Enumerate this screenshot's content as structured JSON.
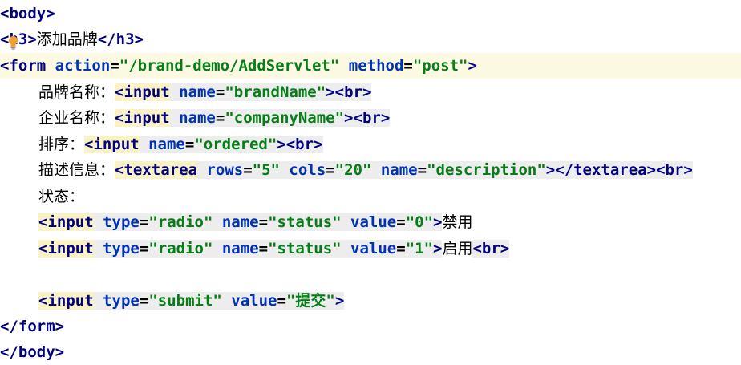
{
  "editor": {
    "language": "html",
    "lines": [
      {
        "tag_open": "<body>"
      },
      {
        "tag_open": "<h3>",
        "text": "添加品牌",
        "tag_close": "</h3>"
      },
      {
        "tag_open": "<form",
        "attrs": [
          {
            "name": "action",
            "value": "\"/brand-demo/AddServlet\""
          },
          {
            "name": "method",
            "value": "\"post\""
          }
        ],
        "tag_end": ">"
      },
      {
        "label": "品牌名称：",
        "tag_open": "<input",
        "attrs": [
          {
            "name": "name",
            "value": "\"brandName\""
          }
        ],
        "tag_end": ">",
        "trailing_tag": "<br>"
      },
      {
        "label": "企业名称：",
        "tag_open": "<input",
        "attrs": [
          {
            "name": "name",
            "value": "\"companyName\""
          }
        ],
        "tag_end": ">",
        "trailing_tag": "<br>"
      },
      {
        "label": "排序：",
        "tag_open": "<input",
        "attrs": [
          {
            "name": "name",
            "value": "\"ordered\""
          }
        ],
        "tag_end": ">",
        "trailing_tag": "<br>"
      },
      {
        "label": "描述信息：",
        "tag_open": "<textarea",
        "attrs": [
          {
            "name": "rows",
            "value": "\"5\""
          },
          {
            "name": "cols",
            "value": "\"20\""
          },
          {
            "name": "name",
            "value": "\"description\""
          }
        ],
        "tag_end": "></textarea>",
        "trailing_tag": "<br>"
      },
      {
        "label": "状态："
      },
      {
        "tag_open": "<input",
        "attrs": [
          {
            "name": "type",
            "value": "\"radio\""
          },
          {
            "name": "name",
            "value": "\"status\""
          },
          {
            "name": "value",
            "value": "\"0\""
          }
        ],
        "tag_end": ">",
        "text": "禁用"
      },
      {
        "tag_open": "<input",
        "attrs": [
          {
            "name": "type",
            "value": "\"radio\""
          },
          {
            "name": "name",
            "value": "\"status\""
          },
          {
            "name": "value",
            "value": "\"1\""
          }
        ],
        "tag_end": ">",
        "text": "启用",
        "trailing_tag": "<br>"
      },
      {},
      {
        "tag_open": "<input",
        "attrs": [
          {
            "name": "type",
            "value": "\"submit\""
          },
          {
            "name": "value",
            "value": "\"提交\""
          }
        ],
        "tag_end": ">"
      },
      {
        "tag_open": "</form>"
      },
      {
        "tag_open": "</body>"
      }
    ]
  },
  "colors": {
    "tag": "#000080",
    "attr_name": "#0033b3",
    "attr_value": "#067d17",
    "current_line": "#fbf9e2",
    "tag_match": "#ededed",
    "bulb": "#f2a03a"
  },
  "icons": {
    "intention_bulb": "lightbulb-icon"
  }
}
